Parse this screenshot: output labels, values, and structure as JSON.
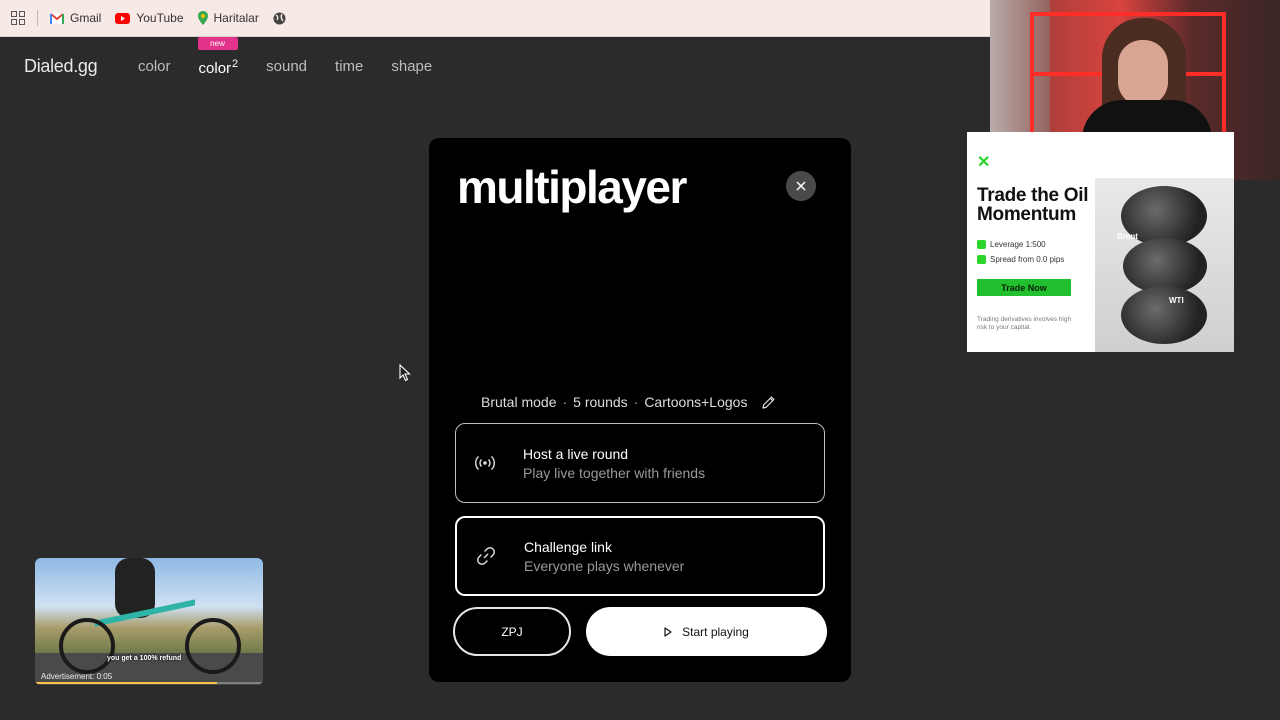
{
  "bookmarks": {
    "items": [
      {
        "label": "Gmail",
        "icon": "gmail-icon"
      },
      {
        "label": "YouTube",
        "icon": "youtube-icon"
      },
      {
        "label": "Haritalar",
        "icon": "maps-icon"
      }
    ]
  },
  "site": {
    "logo": "Dialed.gg",
    "nav": [
      {
        "label": "color"
      },
      {
        "label": "color",
        "sup": "2",
        "badge": "new",
        "active": true
      },
      {
        "label": "sound"
      },
      {
        "label": "time"
      },
      {
        "label": "shape"
      }
    ]
  },
  "modal": {
    "title": "multiplayer",
    "settings": {
      "mode": "Brutal mode",
      "rounds": "5 rounds",
      "category": "Cartoons+Logos",
      "separator": "·"
    },
    "host": {
      "title": "Host a live round",
      "subtitle": "Play live together with friends"
    },
    "challenge": {
      "title": "Challenge link",
      "subtitle": "Everyone plays whenever"
    },
    "code_button": "ZPJ",
    "start_button": "Start playing"
  },
  "ad": {
    "title": "Trade the Oil Momentum",
    "bullets": [
      "Leverage 1:500",
      "Spread from 0.0 pips"
    ],
    "cta": "Trade Now",
    "disclaimer": "Trading derivatives involves high risk to your capital.",
    "labels": {
      "brent": "Brent",
      "wti": "WTI"
    },
    "accent_color": "#22c02e"
  },
  "video": {
    "caption": "you get a 100% refund",
    "ad_label": "Advertisement: 0:05",
    "progress": 0.8
  },
  "colors": {
    "background": "#2b2b2b",
    "modal": "#000000",
    "badge": "#e2338a"
  }
}
